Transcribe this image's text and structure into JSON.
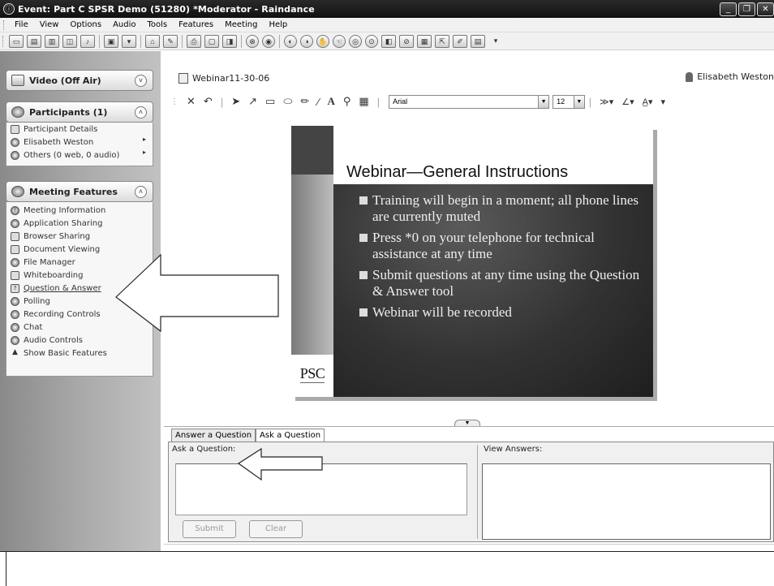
{
  "window": {
    "title": "Event: Part C SPSR Demo (51280) *Moderator - Raindance",
    "controls": [
      "_",
      "❐",
      "✕"
    ]
  },
  "menu": [
    "File",
    "View",
    "Options",
    "Audio",
    "Tools",
    "Features",
    "Meeting",
    "Help"
  ],
  "sidebar": {
    "video": {
      "label": "Video (Off Air)",
      "toggle": "˅"
    },
    "participants": {
      "label": "Participants (1)",
      "toggle": "˄",
      "items": [
        {
          "label": "Participant Details",
          "arrow": ""
        },
        {
          "label": "Elisabeth Weston",
          "arrow": "▸"
        },
        {
          "label": "Others (0 web, 0 audio)",
          "arrow": "▸"
        }
      ]
    },
    "features": {
      "label": "Meeting Features",
      "toggle": "˄",
      "items": [
        {
          "label": "Meeting Information",
          "icon": "info-icon"
        },
        {
          "label": "Application Sharing",
          "icon": "application-sharing-icon"
        },
        {
          "label": "Browser Sharing",
          "icon": "browser-sharing-icon"
        },
        {
          "label": "Document Viewing",
          "icon": "document-icon"
        },
        {
          "label": "File Manager",
          "icon": "file-manager-icon"
        },
        {
          "label": "Whiteboarding",
          "icon": "whiteboard-icon"
        },
        {
          "label": "Question & Answer",
          "icon": "question-icon"
        },
        {
          "label": "Polling",
          "icon": "polling-icon"
        },
        {
          "label": "Recording Controls",
          "icon": "record-icon"
        },
        {
          "label": "Chat",
          "icon": "chat-icon"
        },
        {
          "label": "Audio Controls",
          "icon": "audio-icon"
        },
        {
          "label": "Show Basic Features",
          "icon": "triangle-up-icon"
        }
      ]
    }
  },
  "document": {
    "name": "Webinar11-30-06",
    "presenter": "Elisabeth Weston"
  },
  "annotation_toolbar": {
    "font": "Arial",
    "size": "12"
  },
  "slide": {
    "title": "Webinar—General Instructions",
    "bullets": [
      "Training will begin in a moment; all phone lines are currently muted",
      "Press *0 on your telephone for technical assistance at any time",
      "Submit questions at any time using the Question & Answer tool",
      "Webinar will be recorded"
    ],
    "logo": "PSC"
  },
  "qa": {
    "tabs": [
      "Answer a Question",
      "Ask a Question"
    ],
    "ask_label": "Ask a Question:",
    "answers_label": "View Answers:",
    "submit": "Submit",
    "clear": "Clear"
  },
  "colors": {
    "titlebar": "#1a1a1a",
    "sidebar": "#a9a9a9",
    "slide_bg": "#333333"
  }
}
